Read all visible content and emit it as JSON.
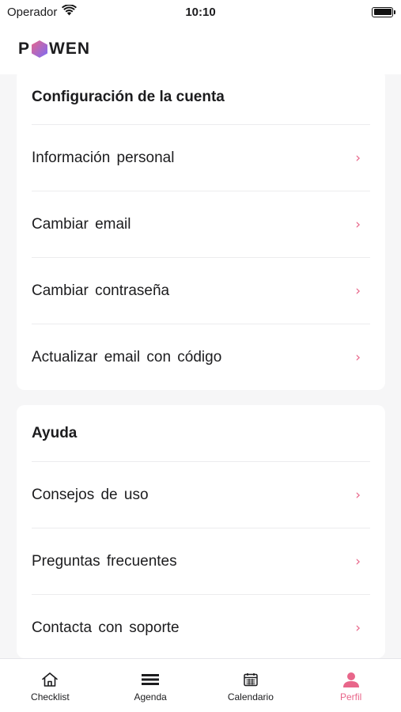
{
  "status_bar": {
    "carrier": "Operador",
    "time": "10:10"
  },
  "header": {
    "logo_left": "P",
    "logo_right": "WEN"
  },
  "account_section": {
    "title": "Configuración de la cuenta",
    "items": [
      {
        "label": "Información personal"
      },
      {
        "label": "Cambiar email"
      },
      {
        "label": "Cambiar contraseña"
      },
      {
        "label": "Actualizar email con código"
      }
    ]
  },
  "help_section": {
    "title": "Ayuda",
    "items": [
      {
        "label": "Consejos de uso"
      },
      {
        "label": "Preguntas frecuentes"
      },
      {
        "label": "Contacta con soporte"
      }
    ]
  },
  "chevron": "›",
  "tab_bar": {
    "tabs": [
      {
        "label": "Checklist",
        "icon": "home-icon"
      },
      {
        "label": "Agenda",
        "icon": "agenda-icon"
      },
      {
        "label": "Calendario",
        "icon": "calendar-icon"
      },
      {
        "label": "Perfil",
        "icon": "person-icon",
        "active": true
      }
    ]
  },
  "colors": {
    "accent": "#e8668a",
    "logo_gradient_start": "#e8668a",
    "logo_gradient_end": "#7b6cf6"
  }
}
